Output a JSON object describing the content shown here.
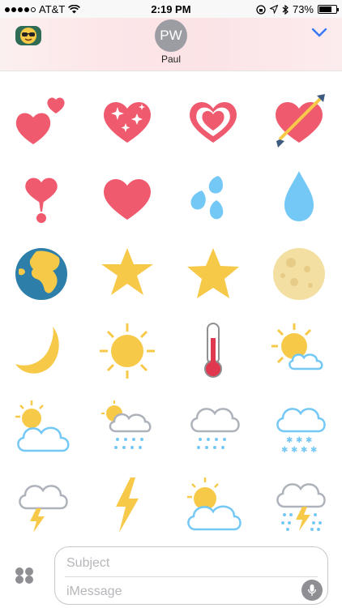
{
  "status_bar": {
    "carrier": "AT&T",
    "time": "2:19 PM",
    "battery_percent": "73%",
    "battery_level": 0.73,
    "signal_bars": 4,
    "icons": [
      "wifi-icon",
      "orientation-lock-icon",
      "location-icon",
      "bluetooth-icon",
      "battery-icon"
    ]
  },
  "header": {
    "avatar_initials": "PW",
    "contact_name": "Paul",
    "app_icon": "sunglasses-face-icon",
    "collapse_icon": "chevron-down-icon",
    "accent_color": "#3478f6"
  },
  "stickers": [
    {
      "name": "two-hearts"
    },
    {
      "name": "sparkling-heart"
    },
    {
      "name": "growing-heart"
    },
    {
      "name": "heart-with-arrow"
    },
    {
      "name": "heart-exclamation"
    },
    {
      "name": "red-heart"
    },
    {
      "name": "sweat-droplets"
    },
    {
      "name": "droplet"
    },
    {
      "name": "globe-europe-africa"
    },
    {
      "name": "glowing-star"
    },
    {
      "name": "star"
    },
    {
      "name": "full-moon"
    },
    {
      "name": "crescent-moon"
    },
    {
      "name": "sun"
    },
    {
      "name": "thermometer"
    },
    {
      "name": "sun-behind-small-cloud"
    },
    {
      "name": "sun-behind-cloud"
    },
    {
      "name": "sun-behind-rain-cloud"
    },
    {
      "name": "cloud-with-rain"
    },
    {
      "name": "cloud-with-snow"
    },
    {
      "name": "cloud-with-lightning"
    },
    {
      "name": "high-voltage"
    },
    {
      "name": "sun-behind-large-cloud"
    },
    {
      "name": "cloud-with-lightning-and-rain"
    }
  ],
  "composer": {
    "apps_icon": "app-drawer-icon",
    "subject_placeholder": "Subject",
    "message_placeholder": "iMessage",
    "mic_icon": "microphone-icon"
  }
}
